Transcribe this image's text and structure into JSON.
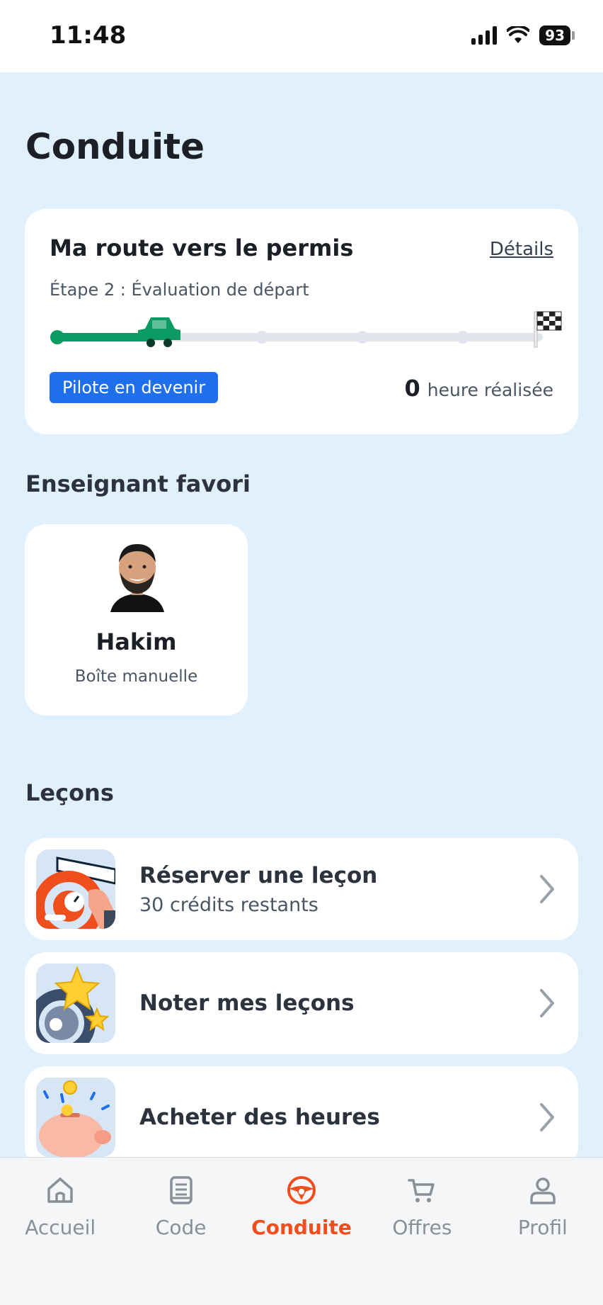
{
  "status_bar": {
    "time": "11:48",
    "battery": "93"
  },
  "page_title": "Conduite",
  "route_card": {
    "title": "Ma route vers le permis",
    "details_link": "Détails",
    "step": "Étape 2 : Évaluation de départ",
    "progress_fraction": 0.2,
    "level_badge": "Pilote en devenir",
    "hours_value": "0",
    "hours_label": "heure réalisée",
    "accent": "#0b9a64"
  },
  "favorite_teacher": {
    "section_title": "Enseignant favori",
    "name": "Hakim",
    "transmission": "Boîte manuelle"
  },
  "lessons": {
    "section_title": "Leçons",
    "items": [
      {
        "title": "Réserver une leçon",
        "subtitle": "30 crédits restants",
        "icon": "steering-wheel-icon"
      },
      {
        "title": "Noter mes leçons",
        "subtitle": "",
        "icon": "star-rating-icon"
      },
      {
        "title": "Acheter des heures",
        "subtitle": "",
        "icon": "piggy-bank-icon"
      }
    ]
  },
  "bottom_nav": {
    "items": [
      {
        "label": "Accueil",
        "icon": "home-icon",
        "active": false
      },
      {
        "label": "Code",
        "icon": "book-icon",
        "active": false
      },
      {
        "label": "Conduite",
        "icon": "steering-wheel-icon",
        "active": true
      },
      {
        "label": "Offres",
        "icon": "cart-icon",
        "active": false
      },
      {
        "label": "Profil",
        "icon": "user-icon",
        "active": false
      }
    ],
    "active_color": "#f04e1d"
  }
}
